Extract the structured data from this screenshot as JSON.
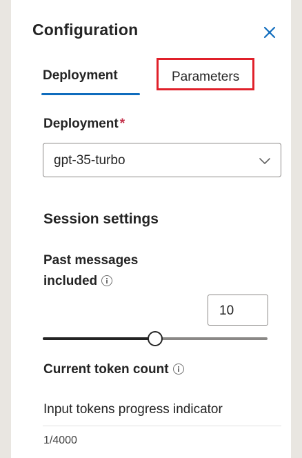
{
  "panel": {
    "title": "Configuration",
    "close_icon": "close-icon"
  },
  "tabs": [
    {
      "label": "Deployment",
      "selected": true
    },
    {
      "label": "Parameters",
      "selected": false,
      "highlighted": true
    }
  ],
  "deployment": {
    "label": "Deployment",
    "required_marker": "*",
    "selected_value": "gpt-35-turbo",
    "chevron_icon": "chevron-down-icon"
  },
  "session": {
    "heading": "Session settings",
    "past_messages_label_line1": "Past messages",
    "past_messages_label_line2": "included",
    "past_messages_value": "10",
    "slider_min": 0,
    "slider_max": 20,
    "slider_value": 10
  },
  "tokens": {
    "label": "Current token count",
    "progress_label": "Input tokens progress indicator",
    "count_text": "1/4000"
  },
  "colors": {
    "accent": "#0f6cbd",
    "highlight_border": "#e0202a",
    "required": "#c4314b",
    "background": "#e9e6e1"
  }
}
